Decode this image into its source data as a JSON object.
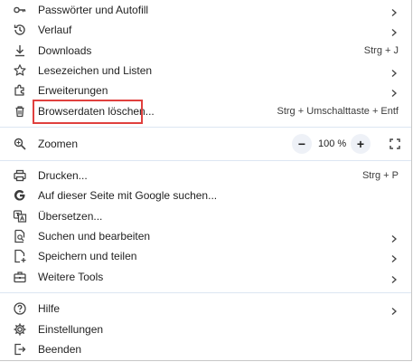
{
  "menu": {
    "passwords": {
      "label": "Passwörter und Autofill",
      "icon": "key-icon"
    },
    "history": {
      "label": "Verlauf",
      "icon": "history-icon"
    },
    "downloads": {
      "label": "Downloads",
      "shortcut": "Strg + J",
      "icon": "download-icon"
    },
    "bookmarks": {
      "label": "Lesezeichen und Listen",
      "icon": "star-icon"
    },
    "extensions": {
      "label": "Erweiterungen",
      "icon": "puzzle-icon"
    },
    "clear_data": {
      "label": "Browserdaten löschen...",
      "shortcut": "Strg + Umschalttaste + Entf",
      "icon": "trash-icon"
    },
    "zoom": {
      "label": "Zoomen",
      "minus": "−",
      "value": "100 %",
      "plus": "+",
      "icon": "zoom-icon"
    },
    "print": {
      "label": "Drucken...",
      "shortcut": "Strg + P",
      "icon": "printer-icon"
    },
    "google_search": {
      "label": "Auf dieser Seite mit Google suchen...",
      "icon": "google-icon"
    },
    "translate": {
      "label": "Übersetzen...",
      "icon": "translate-icon"
    },
    "find_edit": {
      "label": "Suchen und bearbeiten",
      "icon": "find-page-icon"
    },
    "save_share": {
      "label": "Speichern und teilen",
      "icon": "save-share-icon"
    },
    "more_tools": {
      "label": "Weitere Tools",
      "icon": "toolbox-icon"
    },
    "help": {
      "label": "Hilfe",
      "icon": "help-icon"
    },
    "settings": {
      "label": "Einstellungen",
      "icon": "gear-icon"
    },
    "exit": {
      "label": "Beenden",
      "icon": "exit-icon"
    }
  },
  "colors": {
    "highlight": "#e0403e",
    "separator": "#dce6f2",
    "zoom_button_bg": "#eef1f7"
  }
}
